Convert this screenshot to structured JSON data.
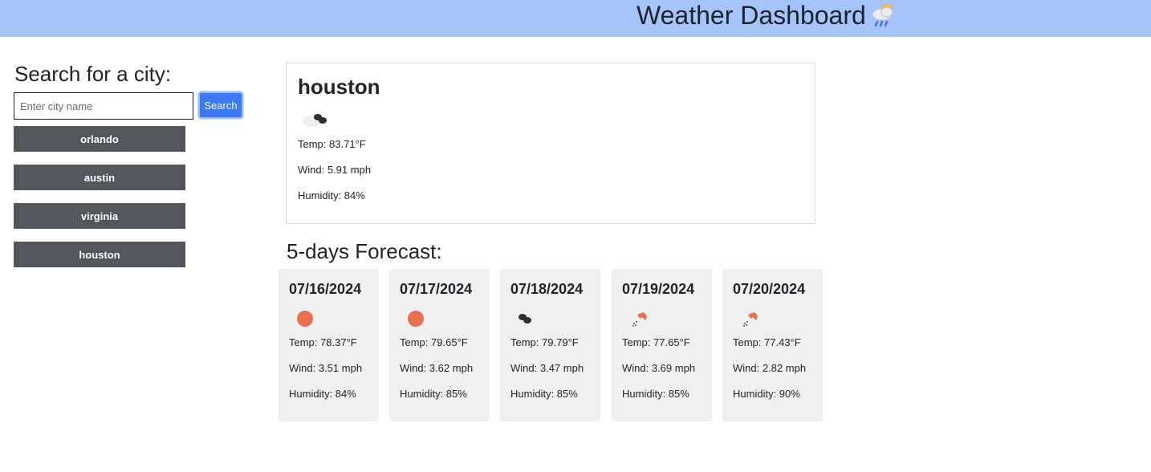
{
  "header": {
    "title": "Weather Dashboard",
    "icon": "cloud-rain-sun-icon"
  },
  "search": {
    "heading": "Search for a city:",
    "placeholder": "Enter city name",
    "value": "",
    "button_label": "Search"
  },
  "history": [
    {
      "label": "orlando"
    },
    {
      "label": "austin"
    },
    {
      "label": "virginia"
    },
    {
      "label": "houston"
    }
  ],
  "current": {
    "city": "houston",
    "icon": "broken-clouds-icon",
    "temp": "Temp: 83.71°F",
    "wind": "Wind: 5.91 mph",
    "humidity": "Humidity: 84%"
  },
  "forecast": {
    "heading": "5-days Forecast:",
    "days": [
      {
        "date": "07/16/2024",
        "icon": "clear-sun-icon",
        "temp": "Temp: 78.37°F",
        "wind": "Wind: 3.51 mph",
        "humidity": "Humidity: 84%"
      },
      {
        "date": "07/17/2024",
        "icon": "clear-sun-icon",
        "temp": "Temp: 79.65°F",
        "wind": "Wind: 3.62 mph",
        "humidity": "Humidity: 85%"
      },
      {
        "date": "07/18/2024",
        "icon": "broken-clouds-icon",
        "temp": "Temp: 79.79°F",
        "wind": "Wind: 3.47 mph",
        "humidity": "Humidity: 85%"
      },
      {
        "date": "07/19/2024",
        "icon": "light-rain-icon",
        "temp": "Temp: 77.65°F",
        "wind": "Wind: 3.69 mph",
        "humidity": "Humidity: 85%"
      },
      {
        "date": "07/20/2024",
        "icon": "light-rain-icon",
        "temp": "Temp: 77.43°F",
        "wind": "Wind: 2.82 mph",
        "humidity": "Humidity: 90%"
      }
    ]
  },
  "colors": {
    "header_bg": "#a4c4fa",
    "search_button": "#3b7af2",
    "history_button": "#53565c",
    "forecast_card": "#f0f0f0",
    "sun": "#e8704f"
  }
}
